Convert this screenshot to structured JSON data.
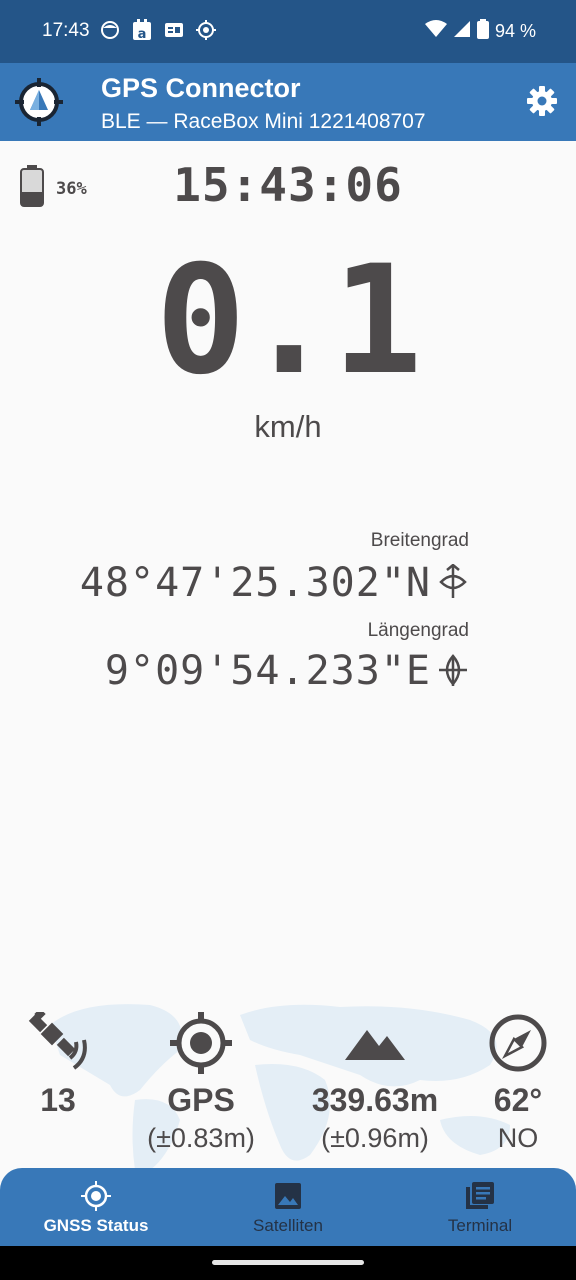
{
  "status_bar": {
    "time": "17:43",
    "battery_text": "94 %",
    "icons": [
      "notification-face-icon",
      "amazon-icon",
      "id-card-icon",
      "gps-status-icon"
    ],
    "right_icons": [
      "wifi-icon",
      "cell-signal-icon",
      "battery-icon"
    ]
  },
  "app_bar": {
    "title": "GPS Connector",
    "subtitle": "BLE — RaceBox Mini 1221408707",
    "accent_color": "#3878b8",
    "status_color": "#245588"
  },
  "device": {
    "battery_percent": "36%",
    "battery_level": 0.36,
    "clock": "15:43:06"
  },
  "speed": {
    "value": "0.1",
    "unit": "km/h"
  },
  "position": {
    "lat_label": "Breitengrad",
    "lat_value": "48°47'25.302\"N",
    "lon_label": "Längengrad",
    "lon_value": "9°09'54.233\"E"
  },
  "stats": {
    "satellites": {
      "value": "13",
      "icon": "satellite-icon"
    },
    "fix": {
      "value": "GPS",
      "accuracy": "(±0.83m)",
      "icon": "crosshair-icon"
    },
    "altitude": {
      "value": "339.63m",
      "accuracy": "(±0.96m)",
      "icon": "mountain-icon"
    },
    "bearing": {
      "value": "62°",
      "direction": "NO",
      "icon": "compass-icon"
    }
  },
  "bottom_nav": {
    "items": [
      {
        "label": "GNSS Status",
        "icon": "gnss-icon",
        "active": true
      },
      {
        "label": "Satelliten",
        "icon": "image-icon",
        "active": false
      },
      {
        "label": "Terminal",
        "icon": "terminal-icon",
        "active": false
      }
    ]
  }
}
